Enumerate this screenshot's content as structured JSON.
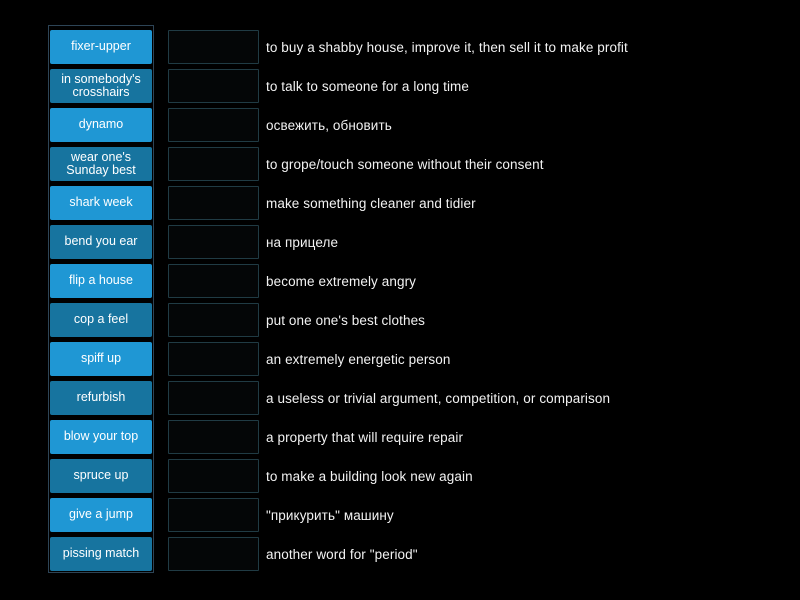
{
  "activity": {
    "type": "match-up-drag-and-drop",
    "background_color": "#000000",
    "tile_color_primary": "#1f97d4",
    "tile_color_secondary": "#17749f",
    "dropzone_border_color": "#203b44",
    "panel_border_color": "#2d4456",
    "text_color": "#ffffff"
  },
  "tiles": [
    {
      "label": "fixer-upper"
    },
    {
      "label": "in somebody's crosshairs"
    },
    {
      "label": "dynamo"
    },
    {
      "label": "wear one's Sunday best"
    },
    {
      "label": "shark week"
    },
    {
      "label": "bend you ear"
    },
    {
      "label": "flip a house"
    },
    {
      "label": "cop a feel"
    },
    {
      "label": "spiff up"
    },
    {
      "label": "refurbish"
    },
    {
      "label": "blow your top"
    },
    {
      "label": "spruce up"
    },
    {
      "label": "give a jump"
    },
    {
      "label": "pissing match"
    }
  ],
  "dropzones": [
    {
      "value": ""
    },
    {
      "value": ""
    },
    {
      "value": ""
    },
    {
      "value": ""
    },
    {
      "value": ""
    },
    {
      "value": ""
    },
    {
      "value": ""
    },
    {
      "value": ""
    },
    {
      "value": ""
    },
    {
      "value": ""
    },
    {
      "value": ""
    },
    {
      "value": ""
    },
    {
      "value": ""
    },
    {
      "value": ""
    }
  ],
  "definitions": [
    {
      "text": "to buy a shabby house, improve it, then sell it to make profit"
    },
    {
      "text": "to talk to someone for a long time"
    },
    {
      "text": "освежить, обновить"
    },
    {
      "text": "to grope/touch someone without their consent"
    },
    {
      "text": "make something cleaner and tidier"
    },
    {
      "text": "на прицеле"
    },
    {
      "text": "become extremely angry"
    },
    {
      "text": "put one one's best clothes"
    },
    {
      "text": "an extremely energetic person"
    },
    {
      "text": "a useless or trivial argument, competition, or comparison"
    },
    {
      "text": "a property that will require repair"
    },
    {
      "text": "to make a building look new again"
    },
    {
      "text": "\"прикурить\" машину"
    },
    {
      "text": "another word for \"period\""
    }
  ]
}
